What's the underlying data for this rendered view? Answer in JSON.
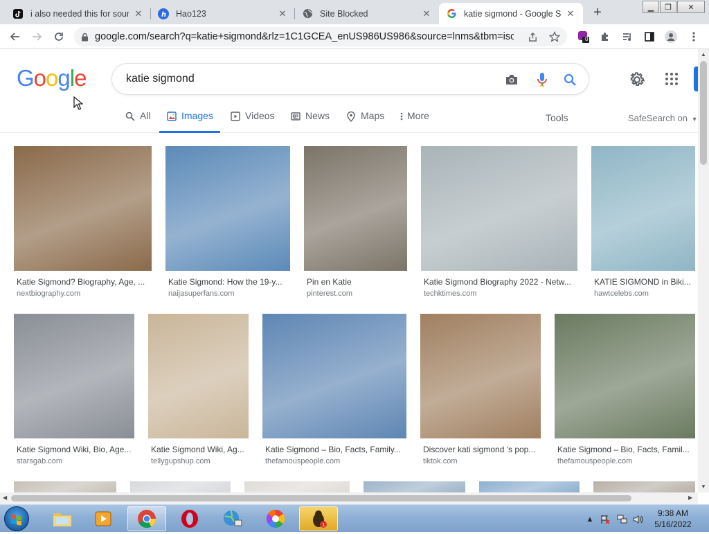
{
  "browser": {
    "tabs": [
      {
        "title": "i also needed this for sound",
        "icon": "tiktok-icon"
      },
      {
        "title": "Hao123",
        "icon": "hao123-icon"
      },
      {
        "title": "Site Blocked",
        "icon": "globe-icon"
      },
      {
        "title": "katie sigmond - Google Se",
        "icon": "google-icon"
      }
    ],
    "url": "google.com/search?q=katie+sigmond&rlz=1C1GCEA_enUS986US986&source=lnms&tbm=isch...",
    "extension_badge": "0"
  },
  "search": {
    "logo": [
      "G",
      "o",
      "o",
      "g",
      "l",
      "e"
    ],
    "query": "katie sigmond",
    "tabs": [
      {
        "label": "All",
        "icon": "search-icon"
      },
      {
        "label": "Images",
        "icon": "image-icon"
      },
      {
        "label": "Videos",
        "icon": "video-icon"
      },
      {
        "label": "News",
        "icon": "news-icon"
      },
      {
        "label": "Maps",
        "icon": "map-pin-icon"
      },
      {
        "label": "More",
        "icon": "more-vert-icon"
      }
    ],
    "active_tab": "Images",
    "tools_label": "Tools",
    "safesearch_label": "SafeSearch on"
  },
  "results": [
    {
      "title": "Katie Sigmond? Biography, Age, ...",
      "source": "nextbiography.com",
      "color": "#8a6a4a"
    },
    {
      "title": "Katie Sigmond: How the 19-y...",
      "source": "naijasuperfans.com",
      "color": "#5c8ab8"
    },
    {
      "title": "Pin en Katie",
      "source": "pinterest.com",
      "color": "#7c7468"
    },
    {
      "title": "Katie Sigmond Biography 2022 - Netw...",
      "source": "techktimes.com",
      "color": "#a9b4b8"
    },
    {
      "title": "KATIE SIGMOND in Biki...",
      "source": "hawtcelebs.com",
      "color": "#8fb6c6"
    },
    {
      "title": "Katie Sigmond Wiki, Bio, Age...",
      "source": "starsgab.com",
      "color": "#8a8e96"
    },
    {
      "title": "Katie Sigmond Wiki, Ag...",
      "source": "tellygupshup.com",
      "color": "#c9b69a"
    },
    {
      "title": "Katie Sigmond – Bio, Facts, Family...",
      "source": "thefamouspeople.com",
      "color": "#5e86b4"
    },
    {
      "title": "Discover kati sigmond 's pop...",
      "source": "tiktok.com",
      "color": "#a08060"
    },
    {
      "title": "Katie Sigmond – Bio, Facts, Famil...",
      "source": "thefamouspeople.com",
      "color": "#6a7a60"
    },
    {
      "title": "",
      "source": "",
      "color": "#c7c0b8"
    },
    {
      "title": "",
      "source": "",
      "color": "#d7d9dc"
    },
    {
      "title": "",
      "source": "",
      "color": "#e0dcd8"
    },
    {
      "title": "",
      "source": "",
      "color": "#9db4c8"
    },
    {
      "title": "",
      "source": "",
      "color": "#8eb0d0"
    },
    {
      "title": "",
      "source": "",
      "color": "#b8b0a8"
    }
  ],
  "taskbar": {
    "time": "9:38 AM",
    "date": "5/16/2022"
  }
}
